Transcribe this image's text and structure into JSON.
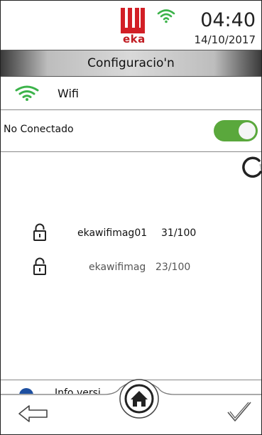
{
  "header": {
    "brand": "eka",
    "time": "04:40",
    "date": "14/10/2017"
  },
  "title_bar": {
    "title": "Configuracio'n"
  },
  "wifi_section": {
    "label": "Wifi"
  },
  "connection": {
    "status_label": "No Conectado",
    "toggle_on": true
  },
  "networks": [
    {
      "ssid": "ekawifimag01",
      "signal": "31/100"
    },
    {
      "ssid": "ekawifimag",
      "signal": "23/100"
    }
  ],
  "footer": {
    "info_label": "Info versi"
  },
  "colors": {
    "brand_red": "#d21f26",
    "wifi_green": "#3cb34a",
    "toggle_green": "#5aa83c",
    "info_blue": "#1d4fa0"
  },
  "icons": {
    "status_wifi": "wifi-icon",
    "section_wifi": "wifi-icon",
    "network_lock": "lock-icon",
    "loading": "spinner-icon",
    "back": "arrow-left-icon",
    "home": "home-icon",
    "confirm": "checkmark-icon",
    "info": "info-icon"
  }
}
